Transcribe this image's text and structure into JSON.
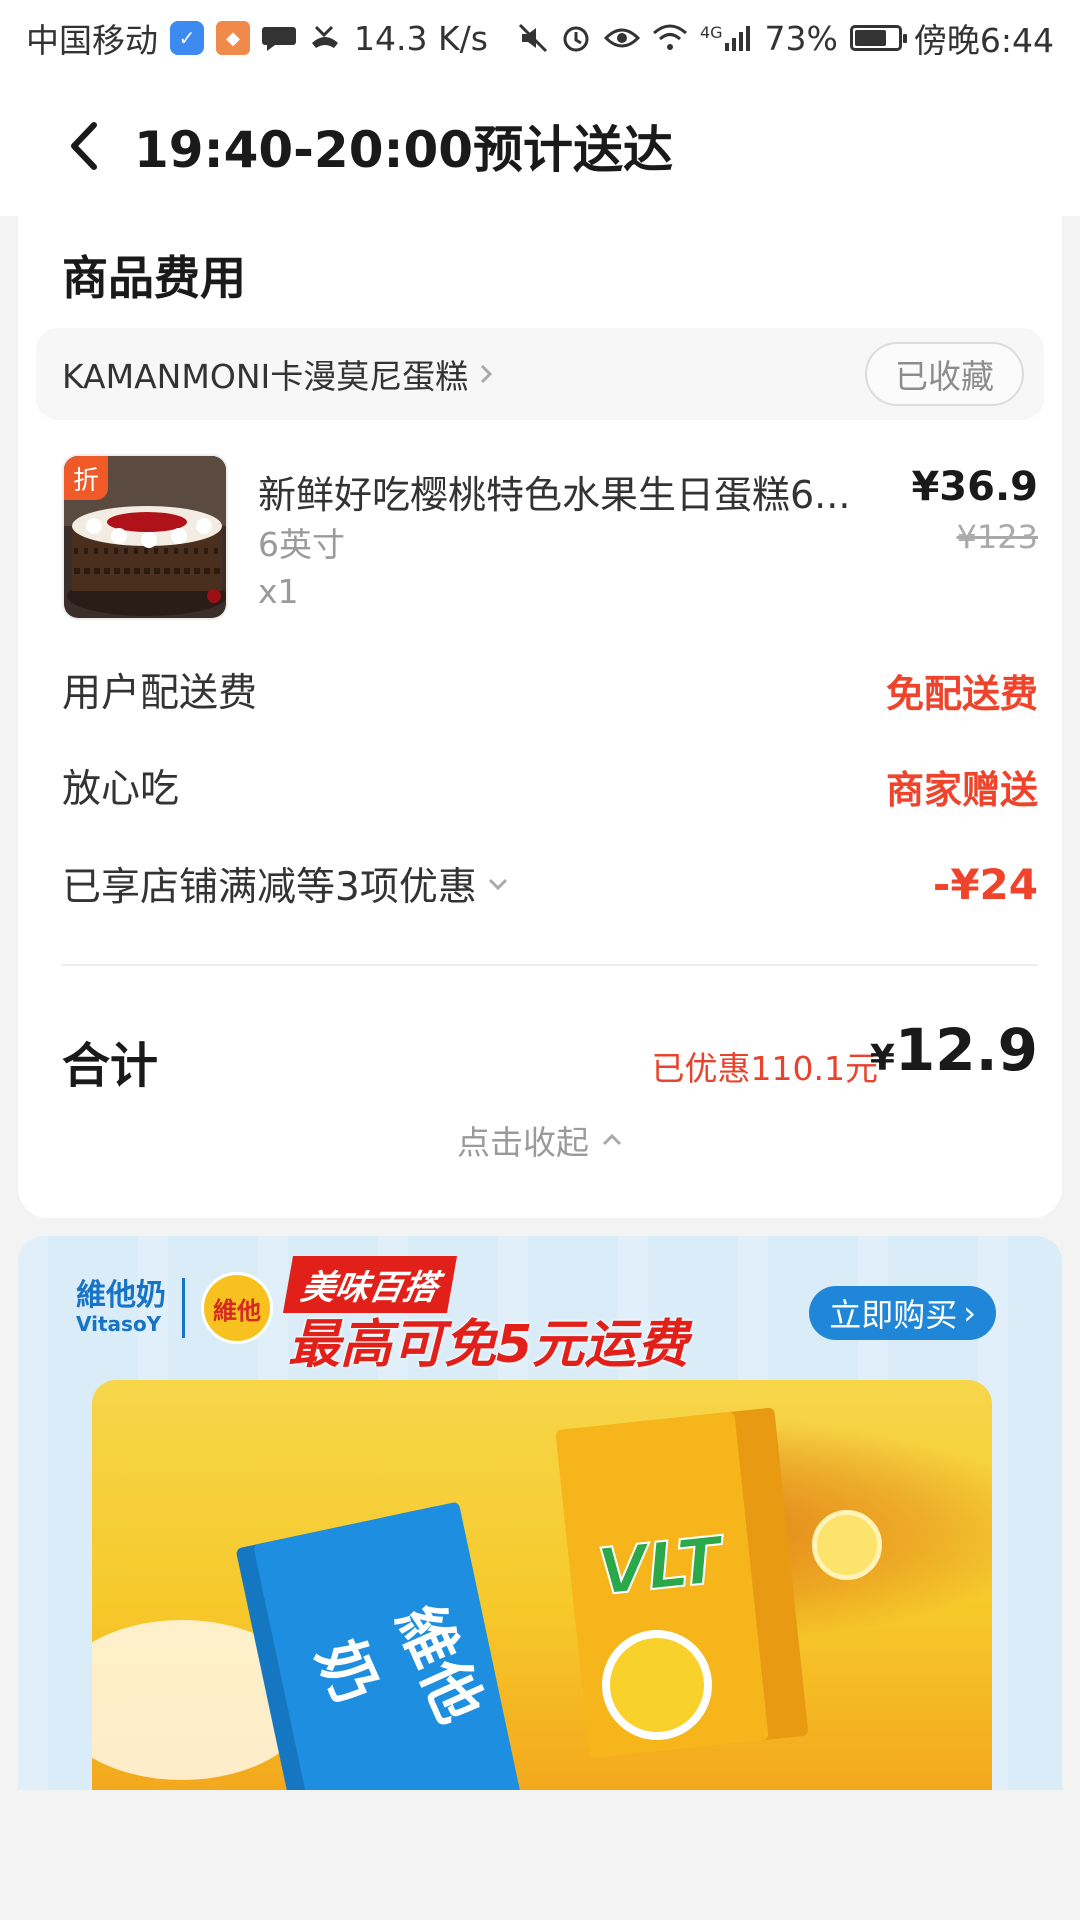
{
  "status_bar": {
    "carrier": "中国移动",
    "speed": "14.3 K/s",
    "network": "4G",
    "battery": "73%",
    "battery_level": 0.73,
    "time": "傍晚6:44"
  },
  "header": {
    "title": "19:40-20:00预计送达"
  },
  "fees": {
    "section_title": "商品费用",
    "store": {
      "name": "KAMANMONI卡漫莫尼蛋糕",
      "fav_label": "已收藏"
    },
    "product": {
      "badge": "折",
      "name": "新鲜好吃樱桃特色水果生日蛋糕6...",
      "spec": "6英寸",
      "qty": "x1",
      "price": "¥36.9",
      "original_price": "¥123"
    },
    "rows": [
      {
        "label": "用户配送费",
        "value": "免配送费"
      },
      {
        "label": "放心吃",
        "value": "商家赠送"
      },
      {
        "label": "已享店铺满减等3项优惠",
        "value": "-¥24"
      }
    ],
    "total": {
      "label": "合计",
      "saved": "已优惠110.1元",
      "currency": "¥",
      "amount": "12.9"
    },
    "collapse_label": "点击收起"
  },
  "banner": {
    "brand_cn": "維他奶",
    "brand_en": "VitasoY",
    "logo_text": "維他",
    "promo_line1": "美味百搭",
    "promo_line2": "最高可免5元运费",
    "buy_label": "立即购买",
    "pack_left_text": "維他奶",
    "pack_right_text": "VLT"
  }
}
